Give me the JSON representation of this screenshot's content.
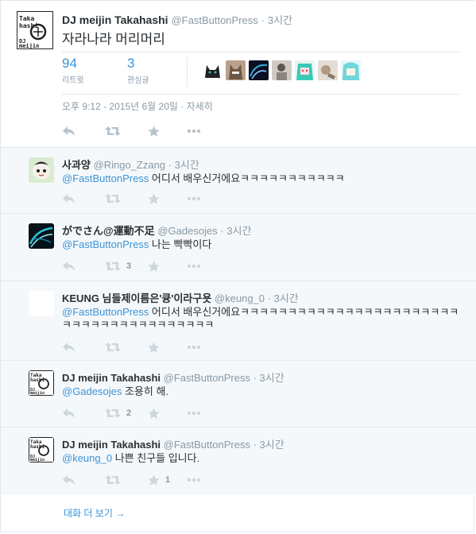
{
  "main_tweet": {
    "fullname": "DJ meijin Takahashi",
    "screen_name": "@FastButtonPress",
    "separator": "·",
    "time": "3시간",
    "text": "자라나라 머리머리",
    "stats": {
      "retweets": {
        "count": "94",
        "label": "리트윗"
      },
      "favorites": {
        "count": "3",
        "label": "관심글"
      }
    },
    "avatar_lettering": [
      "Taka",
      "hashi",
      "DJ",
      "meijin"
    ],
    "favorite_users_count": 7,
    "timestamp": "오후 9:12 - 2015년 6월 20일",
    "details_link": "자세히",
    "meta_sep": " · "
  },
  "replies": [
    {
      "fullname": "사과양",
      "screen_name": "@Ringo_Zzang",
      "time": "3시간",
      "mention": "@FastButtonPress",
      "text": " 어디서 배우신거에요ㅋㅋㅋㅋㅋㅋㅋㅋㅋㅋㅋ",
      "retweet_count": "",
      "favorite_count": ""
    },
    {
      "fullname": "がでさん@運動不足",
      "screen_name": "@Gadesojes",
      "time": "3시간",
      "mention": "@FastButtonPress",
      "text": " 나는 빡빡이다",
      "retweet_count": "3",
      "favorite_count": ""
    },
    {
      "fullname": "KEUNG 님들제이름은'큥'이라구욧",
      "screen_name": "@keung_0",
      "time": "3시간",
      "mention": "@FastButtonPress",
      "text": " 어디서 배우신거에요ㅋㅋㅋㅋㅋㅋㅋㅋㅋㅋㅋㅋㅋㅋㅋㅋㅋㅋㅋㅋㅋㅋㅋㅋㅋㅋㅋㅋㅋㅋㅋㅋㅋㅋㅋㅋㅋㅋㅋ",
      "retweet_count": "",
      "favorite_count": ""
    },
    {
      "fullname": "DJ meijin Takahashi",
      "screen_name": "@FastButtonPress",
      "time": "3시간",
      "mention": "@Gadesojes",
      "text": " 조용히 해.",
      "retweet_count": "2",
      "favorite_count": ""
    },
    {
      "fullname": "DJ meijin Takahashi",
      "screen_name": "@FastButtonPress",
      "time": "3시간",
      "mention": "@keung_0",
      "text": " 나쁜 친구들 입니다.",
      "retweet_count": "",
      "favorite_count": "1"
    }
  ],
  "more_replies_link": "대화 더 보기 →",
  "icons": {
    "reply": "reply-icon",
    "retweet": "retweet-icon",
    "favorite": "star-icon",
    "more": "more-dots-icon"
  },
  "colors": {
    "link": "#3b94d9",
    "muted": "#8899a6",
    "action_icon": "#ccd6dd",
    "reply_bg": "#f5f8fa",
    "border": "#e1e8ed"
  }
}
